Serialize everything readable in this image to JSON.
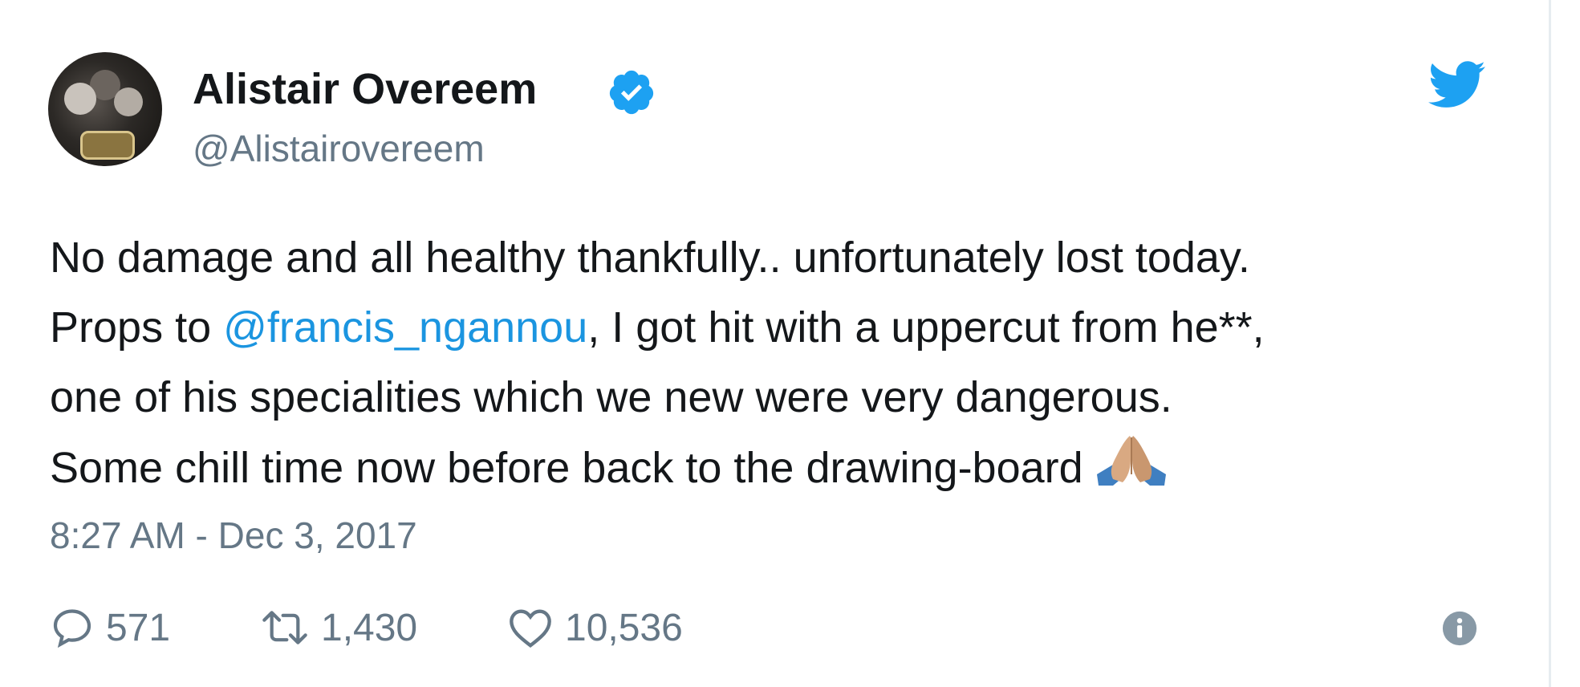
{
  "tweet": {
    "author": {
      "display_name": "Alistair Overeem",
      "handle": "@Alistairovereem",
      "verified": true,
      "avatar_icon": "avatar-photo"
    },
    "text": {
      "line1": "No damage and all healthy thankfully.. unfortunately lost today.",
      "line2_prefix": "Props to ",
      "line2_mention": "@francis_ngannou",
      "line2_suffix": ", I got hit with a uppercut from he**,",
      "line3": "one of his specialities which we new were very dangerous.",
      "line4": "Some chill time now before back to the drawing-board",
      "emoji": "folded-hands-emoji"
    },
    "timestamp": "8:27 AM - Dec 3, 2017",
    "stats": {
      "replies": "571",
      "retweets": "1,430",
      "likes": "10,536"
    },
    "icons": {
      "brand": "twitter-bird-icon",
      "verified": "verified-badge-icon",
      "reply": "reply-icon",
      "retweet": "retweet-icon",
      "like": "heart-icon",
      "info": "info-icon"
    }
  },
  "colors": {
    "accent": "#1da1f2",
    "mention": "#1b95e0",
    "text": "#14171a",
    "secondary": "#657786"
  }
}
